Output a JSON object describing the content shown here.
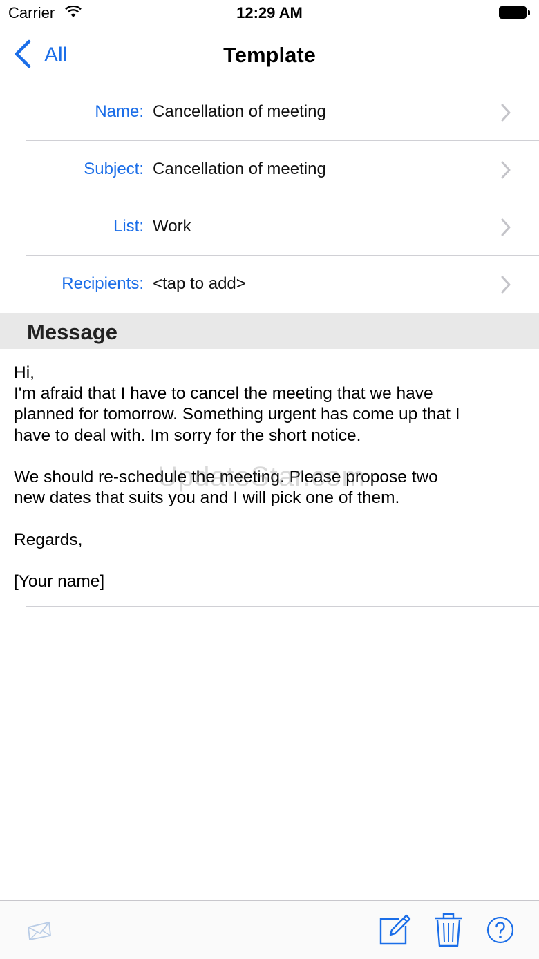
{
  "status_bar": {
    "carrier": "Carrier",
    "time": "12:29 AM"
  },
  "nav": {
    "back_label": "All",
    "title": "Template"
  },
  "fields": [
    {
      "label": "Name:",
      "value": "Cancellation of meeting"
    },
    {
      "label": "Subject:",
      "value": "Cancellation of meeting"
    },
    {
      "label": "List:",
      "value": "Work"
    },
    {
      "label": "Recipients:",
      "value": "<tap to add>"
    }
  ],
  "message": {
    "header": "Message",
    "lines": [
      "Hi,",
      "I'm afraid that I have to cancel the meeting that we have",
      "planned for tomorrow. Something urgent has come up that I",
      "have to deal with. Im sorry for the short notice.",
      "",
      "We should re-schedule the meeting. Please propose two",
      "new dates that suits you and I will pick one of them.",
      "",
      "Regards,",
      "",
      "[Your name]"
    ]
  },
  "watermark": "UpdateStar.com",
  "colors": {
    "accent": "#1b6ee8",
    "separator": "#d0d0d5",
    "section_bg": "#e8e8e8"
  },
  "toolbar": {
    "icons": [
      "send-mail-icon",
      "compose-icon",
      "trash-icon",
      "help-icon"
    ]
  }
}
